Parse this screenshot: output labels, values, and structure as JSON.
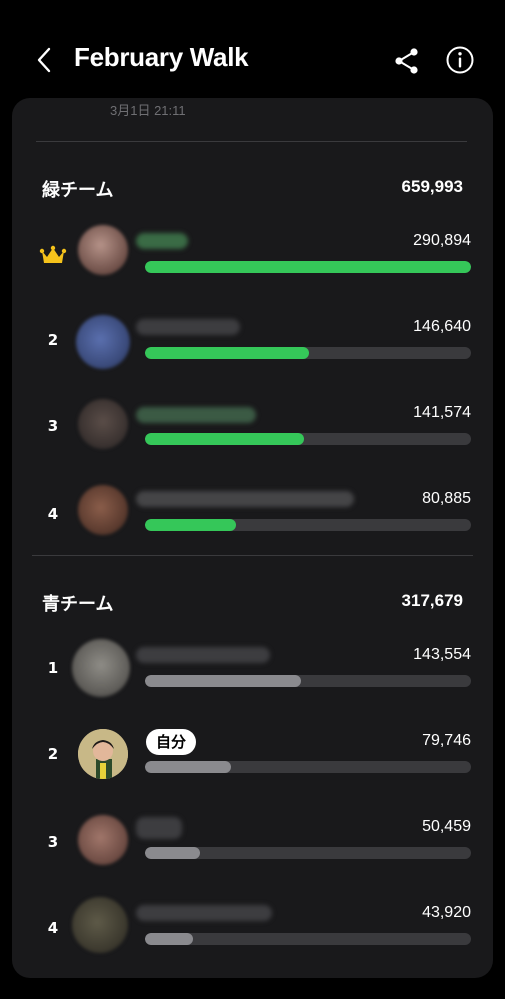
{
  "header": {
    "title": "February Walk"
  },
  "date": "3月1日 21:11",
  "colors": {
    "green": "#35c759",
    "gray": "#8a8a8e",
    "track": "#3a3a3d"
  },
  "teams": [
    {
      "name": "緑チーム",
      "total": "659,993",
      "color": "green",
      "members": [
        {
          "rank": "",
          "crown": true,
          "steps": "290,894",
          "progress": 1.0
        },
        {
          "rank": "2",
          "steps": "146,640",
          "progress": 0.504
        },
        {
          "rank": "3",
          "steps": "141,574",
          "progress": 0.487
        },
        {
          "rank": "4",
          "steps": "80,885",
          "progress": 0.278
        }
      ]
    },
    {
      "name": "青チーム",
      "total": "317,679",
      "color": "gray",
      "members": [
        {
          "rank": "1",
          "steps": "143,554",
          "progress": 0.477
        },
        {
          "rank": "2",
          "steps": "79,746",
          "progress": 0.265,
          "me_label": "自分"
        },
        {
          "rank": "3",
          "steps": "50,459",
          "progress": 0.168
        },
        {
          "rank": "4",
          "steps": "43,920",
          "progress": 0.146
        }
      ]
    }
  ]
}
